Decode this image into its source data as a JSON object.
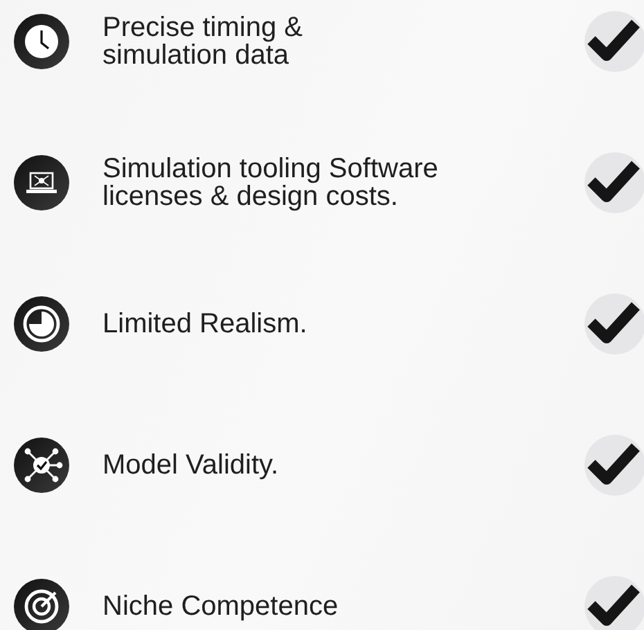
{
  "items": [
    {
      "text": "Precise timing &\nsimulation data",
      "checked": true
    },
    {
      "text": "Simulation tooling Software\nlicenses & design costs.",
      "checked": true
    },
    {
      "text": "Limited Realism.",
      "checked": true
    },
    {
      "text": "Model Validity.",
      "checked": true
    },
    {
      "text": "Niche Competence",
      "checked": true
    }
  ]
}
